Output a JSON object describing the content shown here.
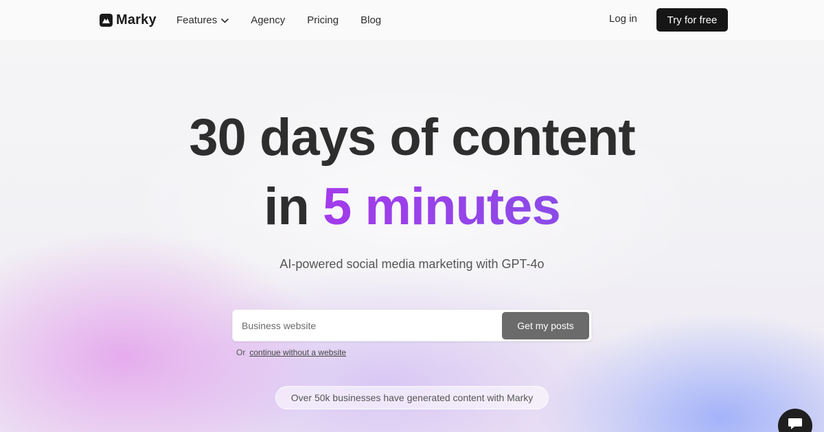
{
  "navbar": {
    "brand": "Marky",
    "links": [
      {
        "label": "Features",
        "has_dropdown": true
      },
      {
        "label": "Agency"
      },
      {
        "label": "Pricing"
      },
      {
        "label": "Blog"
      }
    ],
    "login_label": "Log in",
    "cta_label": "Try for free"
  },
  "hero": {
    "headline_line1": "30 days of content",
    "headline_line2_prefix": "in",
    "headline_line2_accent": "5 minutes",
    "subtitle": "AI-powered social media marketing with GPT-4o"
  },
  "form": {
    "input_placeholder": "Business website",
    "input_value": "",
    "submit_label": "Get my posts",
    "alt_prefix": "Or",
    "alt_link": "continue without a website"
  },
  "social_proof": "Over 50k businesses have generated content with Marky",
  "colors": {
    "accent_start": "#a33bea",
    "accent_end": "#8b4be8",
    "cta_bg": "#161616",
    "submit_bg": "#6b6b6b"
  },
  "icons": {
    "logo": "marky-logo-icon",
    "dropdown": "chevron-down-icon",
    "chat": "chat-icon"
  }
}
